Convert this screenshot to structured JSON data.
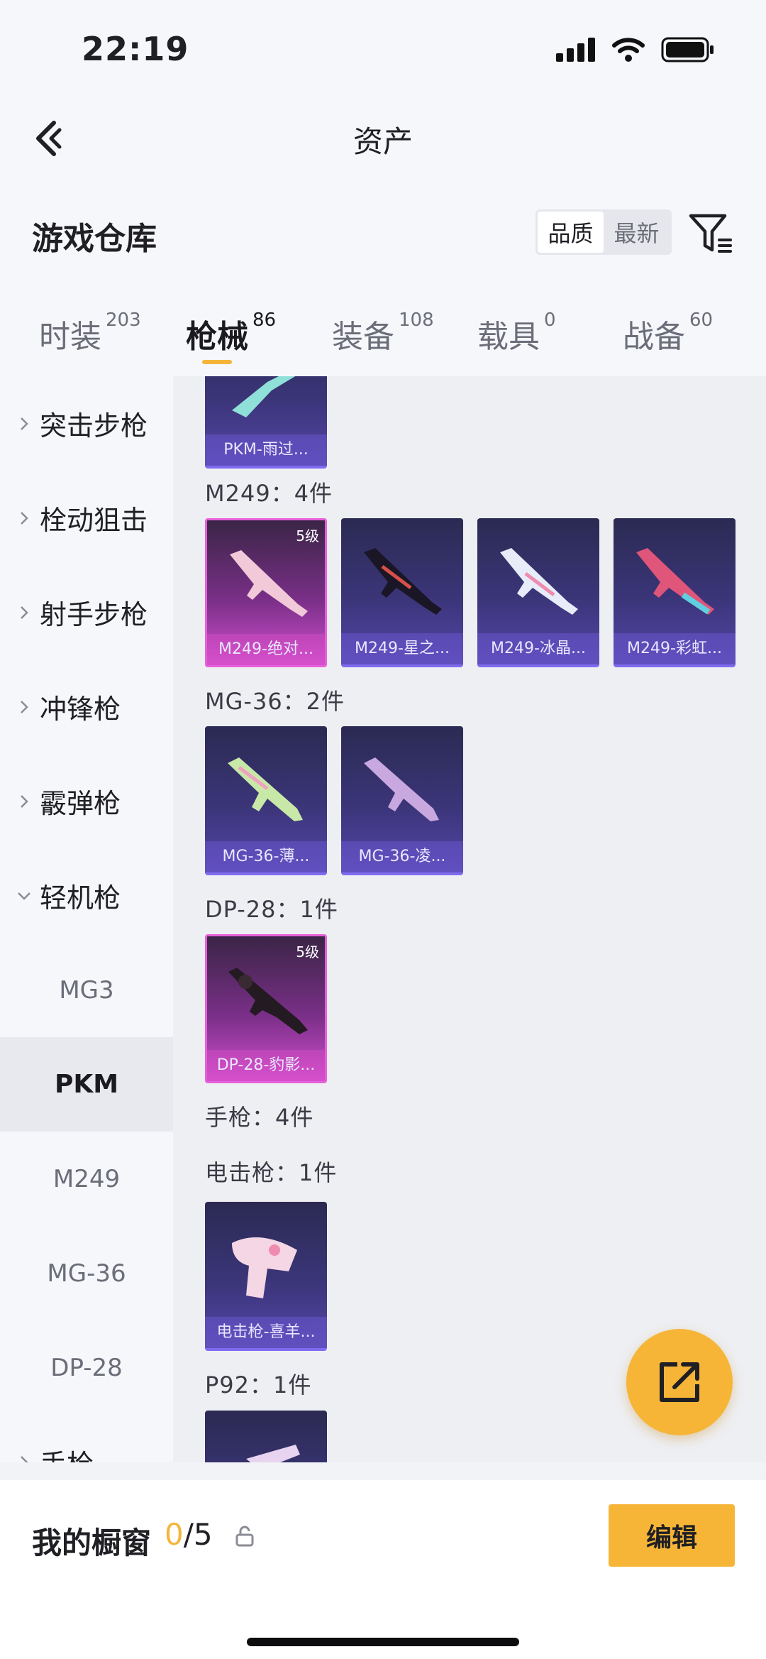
{
  "status_bar": {
    "time": "22:19"
  },
  "header": {
    "title": "资产"
  },
  "warehouse": {
    "title": "游戏仓库",
    "sort_options": [
      "品质",
      "最新"
    ],
    "active_sort": "品质"
  },
  "tabs": [
    {
      "label": "时装",
      "count": "203"
    },
    {
      "label": "枪械",
      "count": "86",
      "active": true
    },
    {
      "label": "装备",
      "count": "108"
    },
    {
      "label": "载具",
      "count": "0"
    },
    {
      "label": "战备",
      "count": "60"
    }
  ],
  "sidebar": {
    "categories": [
      "突击步枪",
      "栓动狙击",
      "射手步枪",
      "冲锋枪",
      "霰弹枪",
      "轻机枪"
    ],
    "sub_items": [
      "MG3",
      "PKM",
      "M249",
      "MG-36",
      "DP-28"
    ],
    "active_sub": "PKM",
    "last_category": "手枪"
  },
  "content": {
    "partial_card": {
      "name": "PKM-雨过..."
    },
    "sections": [
      {
        "title": "M249：4件",
        "items": [
          {
            "name": "M249-绝对...",
            "grade": "5级",
            "rarity": "legend"
          },
          {
            "name": "M249-星之...",
            "rarity": "epic"
          },
          {
            "name": "M249-冰晶...",
            "rarity": "epic"
          },
          {
            "name": "M249-彩虹...",
            "rarity": "epic"
          }
        ]
      },
      {
        "title": "MG-36：2件",
        "items": [
          {
            "name": "MG-36-薄...",
            "rarity": "epic"
          },
          {
            "name": "MG-36-凌...",
            "rarity": "epic"
          }
        ]
      },
      {
        "title": "DP-28：1件",
        "items": [
          {
            "name": "DP-28-豹影...",
            "grade": "5级",
            "rarity": "legend"
          }
        ]
      },
      {
        "title": "手枪：4件",
        "items": []
      },
      {
        "title": "电击枪：1件",
        "items": [
          {
            "name": "电击枪-喜羊...",
            "rarity": "epic"
          }
        ]
      },
      {
        "title": "P92：1件",
        "items": []
      }
    ]
  },
  "bottom_bar": {
    "showcase_label": "我的橱窗",
    "showcase_current": "0",
    "showcase_total": "/5",
    "edit_label": "编辑"
  },
  "colors": {
    "accent": "#f6b537",
    "legend": "#d24fcf",
    "epic": "#5546a8"
  },
  "icons": [
    "back-arrow-icon",
    "filter-icon",
    "chevron-right-icon",
    "chevron-down-icon",
    "share-icon",
    "lock-icon",
    "signal-icon",
    "wifi-icon",
    "battery-icon"
  ]
}
